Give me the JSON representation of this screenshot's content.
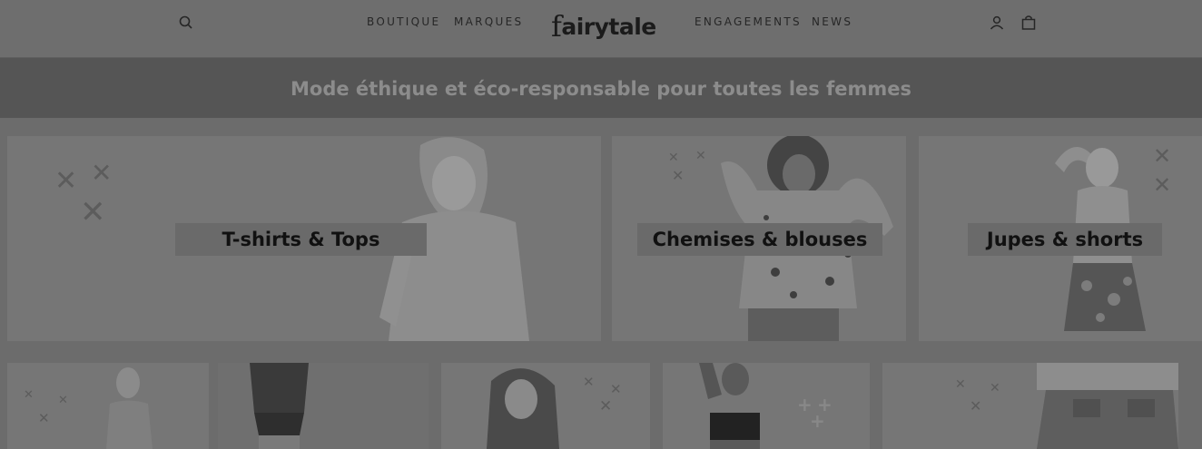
{
  "header": {
    "nav_left": [
      "BOUTIQUE",
      "MARQUES"
    ],
    "nav_right": [
      "ENGAGEMENTS",
      "NEWS"
    ],
    "logo_first": "f",
    "logo_rest": "airytale",
    "icons": [
      "search-icon",
      "account-icon",
      "cart-icon"
    ]
  },
  "banner": {
    "text": "Mode éthique et éco-responsable pour toutes les femmes"
  },
  "categories": [
    {
      "label": "T-shirts & Tops"
    },
    {
      "label": "Chemises & blouses"
    },
    {
      "label": "Jupes & shorts"
    }
  ],
  "colors": {
    "page_bg": "#6c6c6c",
    "banner_bg": "#555555",
    "banner_text": "#8c8c8c",
    "tile_bg": "#767676"
  }
}
